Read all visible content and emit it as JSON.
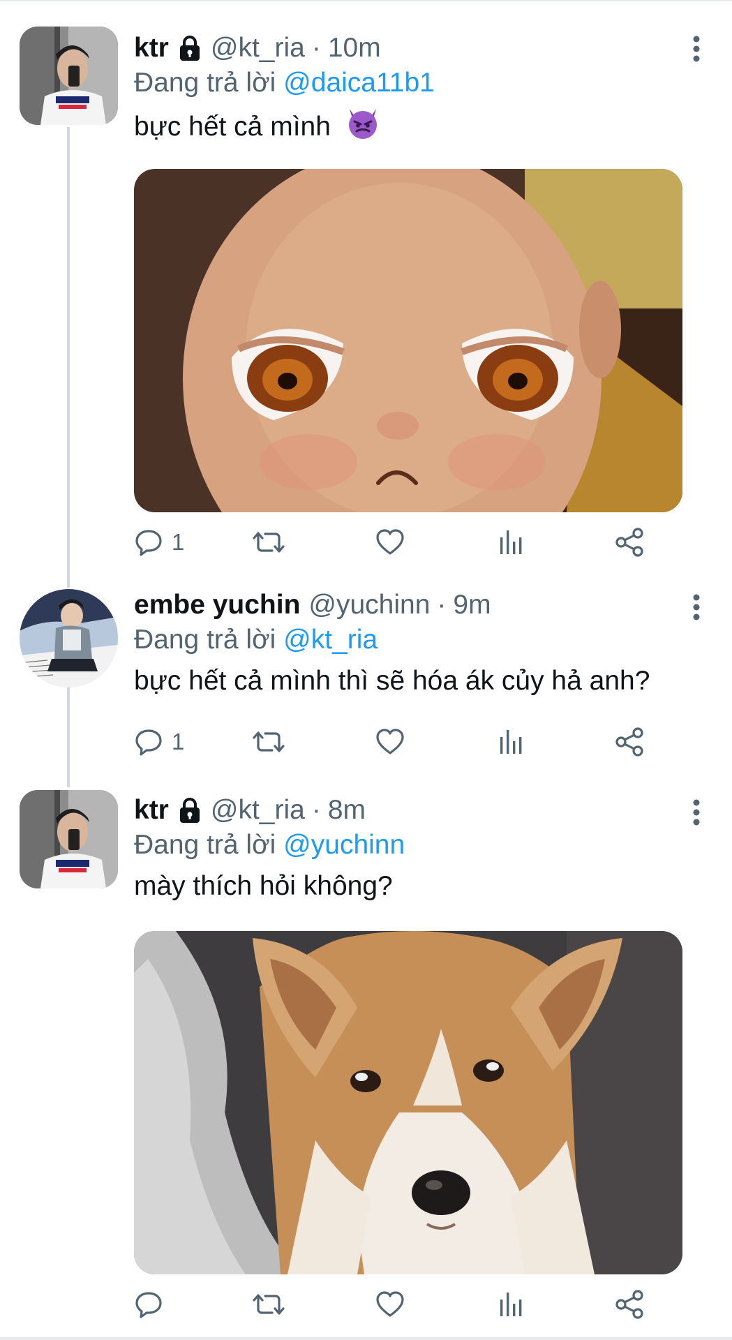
{
  "tweets": [
    {
      "display_name": "ktr",
      "handle": "@kt_ria",
      "separator": "·",
      "time": "10m",
      "reply_prefix": "Đang trả lời",
      "reply_to": "@daica11b1",
      "text": "bực hết cả mình",
      "text_emoji": "devil-emoji",
      "has_media": true,
      "media_subject": "angry-baby-face-image",
      "reply_count": "1"
    },
    {
      "display_name": "embe yuchin",
      "handle": "@yuchinn",
      "separator": "·",
      "time": "9m",
      "reply_prefix": "Đang trả lời",
      "reply_to": "@kt_ria",
      "text": "bực hết cả mình thì sẽ hóa ák củy hả anh?",
      "has_media": false,
      "reply_count": "1"
    },
    {
      "display_name": "ktr",
      "handle": "@kt_ria",
      "separator": "·",
      "time": "8m",
      "reply_prefix": "Đang trả lời",
      "reply_to": "@yuchinn",
      "text": "mày thích hỏi không?",
      "has_media": true,
      "media_subject": "corgi-dog-image",
      "reply_count": ""
    }
  ],
  "icons": {
    "lock": "lock-icon",
    "more": "more-vertical-icon",
    "reply": "reply-bubble-icon",
    "retweet": "retweet-icon",
    "like": "heart-icon",
    "views": "analytics-bars-icon",
    "share": "share-icon"
  },
  "colors": {
    "primary_text": "#0f1419",
    "secondary_text": "#536471",
    "mention_blue": "#1d9bf0",
    "thread_line": "#cfd9de"
  }
}
